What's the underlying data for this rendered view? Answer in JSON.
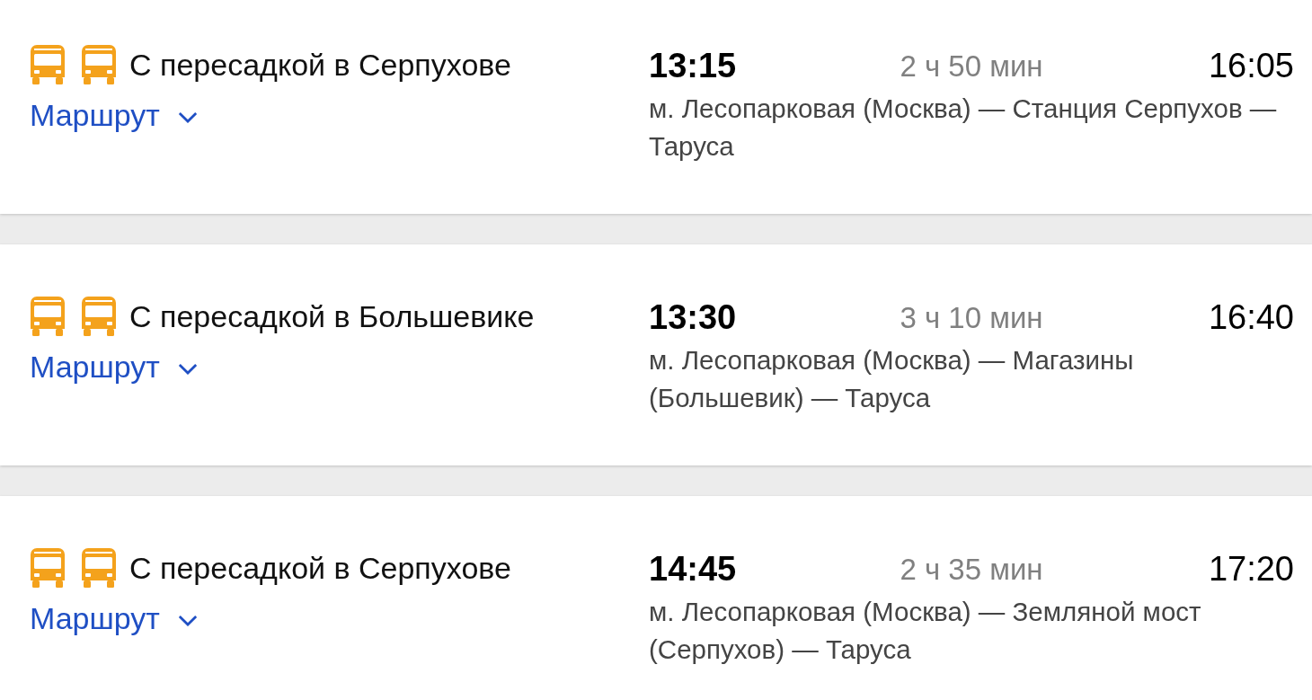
{
  "trips": [
    {
      "transport": [
        {
          "kind": "bus"
        },
        {
          "kind": "bus"
        }
      ],
      "title": "С пересадкой в Серпухове",
      "route_link": {
        "label": "Маршрут",
        "expanded": false
      },
      "departure": "13:15",
      "duration": "2 ч 50 мин",
      "arrival": "16:05",
      "stops": "м. Лесопарковая (Москва) — Станция Серпухов — Таруса"
    },
    {
      "transport": [
        {
          "kind": "bus"
        },
        {
          "kind": "bus"
        }
      ],
      "title": "С пересадкой в Большевике",
      "route_link": {
        "label": "Маршрут",
        "expanded": false
      },
      "departure": "13:30",
      "duration": "3 ч 10 мин",
      "arrival": "16:40",
      "stops": "м. Лесопарковая (Москва) — Магазины (Большевик) — Таруса"
    },
    {
      "transport": [
        {
          "kind": "bus"
        },
        {
          "kind": "bus"
        }
      ],
      "title": "С пересадкой в Серпухове",
      "route_link": {
        "label": "Маршрут",
        "expanded": false
      },
      "departure": "14:45",
      "duration": "2 ч 35 мин",
      "arrival": "17:20",
      "stops": "м. Лесопарковая (Москва) — Земляной мост (Серпухов) — Таруса"
    }
  ]
}
